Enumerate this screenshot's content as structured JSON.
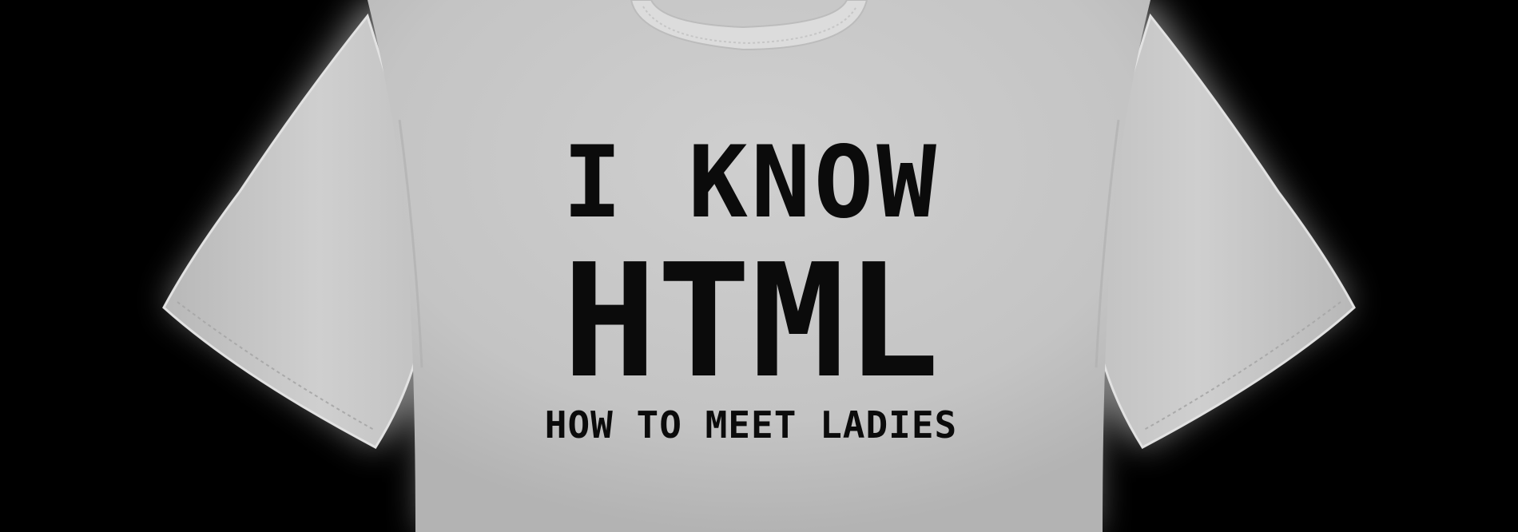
{
  "shirt": {
    "color": "#c9c9c9",
    "background": "#000000",
    "print_color": "#0b0b0b"
  },
  "print": {
    "line1": "I KNOW",
    "line2": "HTML",
    "line3": "HOW TO MEET LADIES"
  }
}
